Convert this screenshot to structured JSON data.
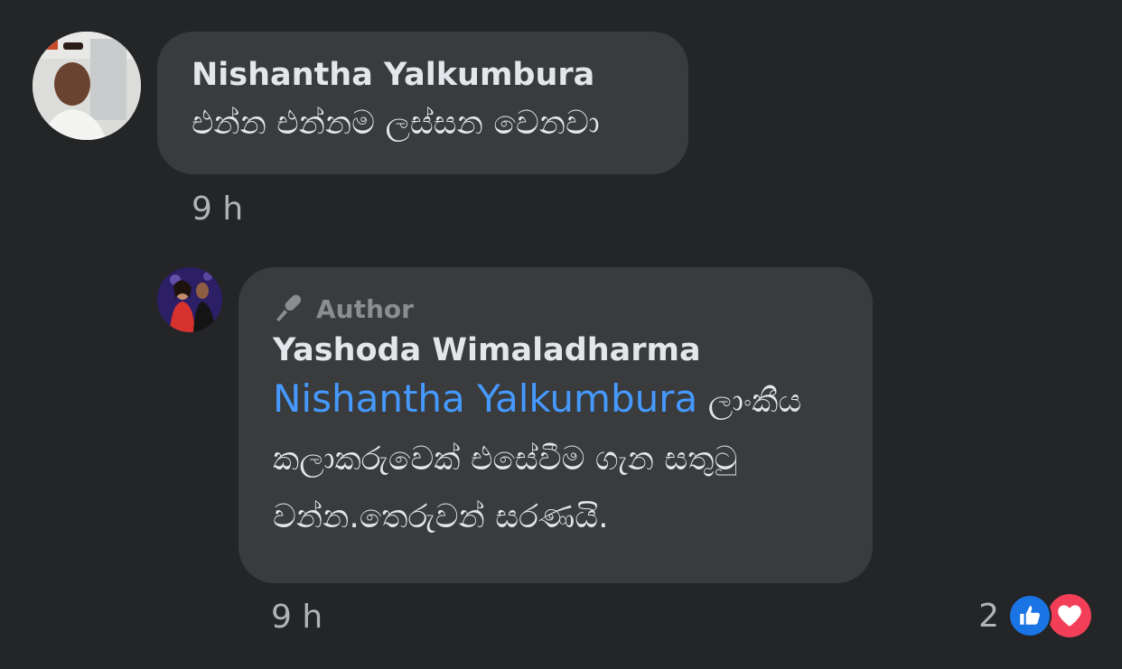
{
  "comment": {
    "author": "Nishantha Yalkumbura",
    "text": "එන්න එන්නම ලස්සන වෙනවා",
    "timestamp": "9 h"
  },
  "reply": {
    "badge": "Author",
    "author": "Yashoda Wimaladharma",
    "mention": "Nishantha Yalkumbura",
    "text": "ලාංකීය කලාකරුවෙක් එසේවීම ගැන සතුටු වන්න.තෙරුවන් සරණයි.",
    "timestamp": "9 h",
    "reaction_count": "2",
    "reactions": [
      "like-icon",
      "love-icon"
    ]
  },
  "colors": {
    "background": "#242526",
    "bubble": "#3a3b3c",
    "mention": "#4599ff",
    "like": "#1b74e4",
    "love": "#f33e58"
  }
}
